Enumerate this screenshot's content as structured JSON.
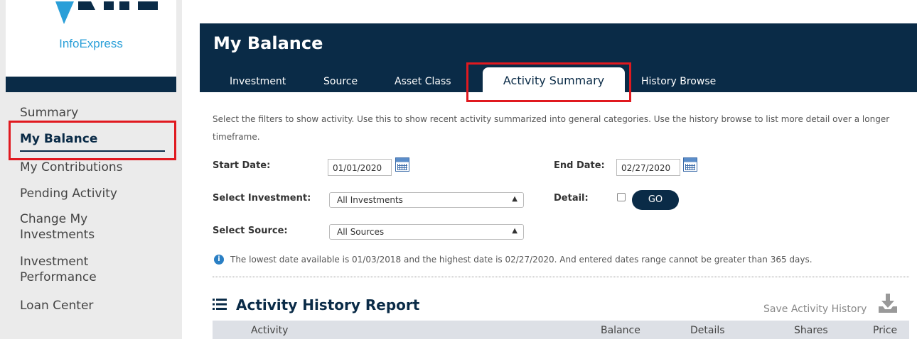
{
  "logo": {
    "name": "InfoExpress"
  },
  "sidebar": {
    "items": [
      {
        "label": "Summary"
      },
      {
        "label": "My Balance"
      },
      {
        "label": "My Contributions"
      },
      {
        "label": "Pending Activity"
      },
      {
        "label": "Change My\nInvestments"
      },
      {
        "label": "Investment\nPerformance"
      },
      {
        "label": "Loan Center"
      }
    ],
    "active_index": 1
  },
  "header": {
    "title": "My Balance",
    "tabs": [
      {
        "label": "Investment"
      },
      {
        "label": "Source"
      },
      {
        "label": "Asset Class"
      },
      {
        "label": "Activity Summary"
      },
      {
        "label": "History Browse"
      }
    ],
    "active_tab": "Activity Summary"
  },
  "content": {
    "description": "Select the filters to show activity. Use this to show recent activity summarized into general categories. Use the history browse to list more detail over a longer timeframe.",
    "start_date_label": "Start Date:",
    "start_date_value": "01/01/2020",
    "end_date_label": "End Date:",
    "end_date_value": "02/27/2020",
    "investment_label": "Select Investment:",
    "investment_value": "All Investments",
    "detail_label": "Detail:",
    "go_label": "GO",
    "source_label": "Select Source:",
    "source_value": "All Sources",
    "info_text": "The lowest date available is 01/03/2018 and the highest date is 02/27/2020. And entered dates range cannot be greater than 365 days."
  },
  "report": {
    "title": "Activity History Report",
    "save_label": "Save Activity History",
    "columns": [
      "Activity",
      "Balance",
      "Details",
      "Shares",
      "Price"
    ]
  },
  "colors": {
    "brand_navy": "#0a2b47",
    "brand_blue": "#2a9fd8",
    "highlight_red": "#e0191f"
  },
  "icons": [
    "calendar-icon",
    "info-icon",
    "list-icon",
    "download-icon",
    "chevron-updown-icon"
  ]
}
